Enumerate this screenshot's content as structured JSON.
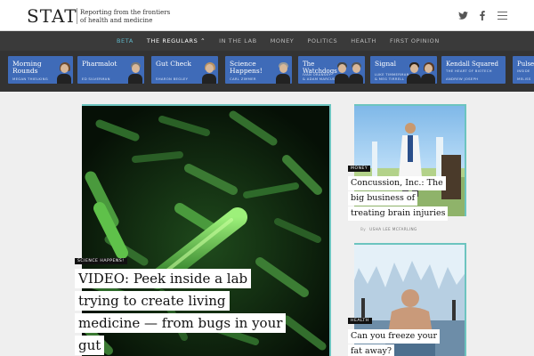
{
  "header": {
    "logo": "STAT",
    "tagline_1": "Reporting from the frontiers",
    "tagline_2": "of health and medicine",
    "icons": [
      "twitter-icon",
      "facebook-icon",
      "menu-icon"
    ]
  },
  "nav": {
    "items": [
      {
        "label": "BETA"
      },
      {
        "label": "THE REGULARS ⌃"
      },
      {
        "label": "IN THE LAB"
      },
      {
        "label": "MONEY"
      },
      {
        "label": "POLITICS"
      },
      {
        "label": "HEALTH"
      },
      {
        "label": "FIRST OPINION"
      }
    ]
  },
  "columns": [
    {
      "title": "Morning\nRounds",
      "author": "MEGAN THIELKING"
    },
    {
      "title": "Pharmalot",
      "author": "ED SILVERMAN"
    },
    {
      "title": "Gut Check",
      "author": "SHARON BEGLEY"
    },
    {
      "title": "Science\nHappens!",
      "author": "CARL ZIMMER"
    },
    {
      "title": "The\nWatchdogs",
      "author": "IVAN ORANSKY\n& ADAM MARCUS"
    },
    {
      "title": "Signal",
      "author": "LUKE TIMMERMAN\n& MEG TIRRELL"
    },
    {
      "title": "Kendall Squared",
      "subtitle": "THE HEART OF BIOTECH",
      "author": "ANDREW JOSEPH"
    },
    {
      "title": "Pulse",
      "subtitle": "INSIDE",
      "author": "MELISS"
    }
  ],
  "hero": {
    "tag": "SCIENCE HAPPENS!",
    "lines": [
      "VIDEO: Peek inside a lab",
      "trying to create living",
      "medicine — from bugs in your",
      "gut"
    ]
  },
  "side1": {
    "tag": "MONEY",
    "lines": [
      "Concussion, Inc.: The",
      "big business of",
      "treating brain injuries"
    ],
    "by": "By",
    "author": "USHA LEE MCFARLING"
  },
  "side2": {
    "tag": "HEALTH",
    "lines": [
      "Can you freeze your",
      "fat away?"
    ]
  }
}
